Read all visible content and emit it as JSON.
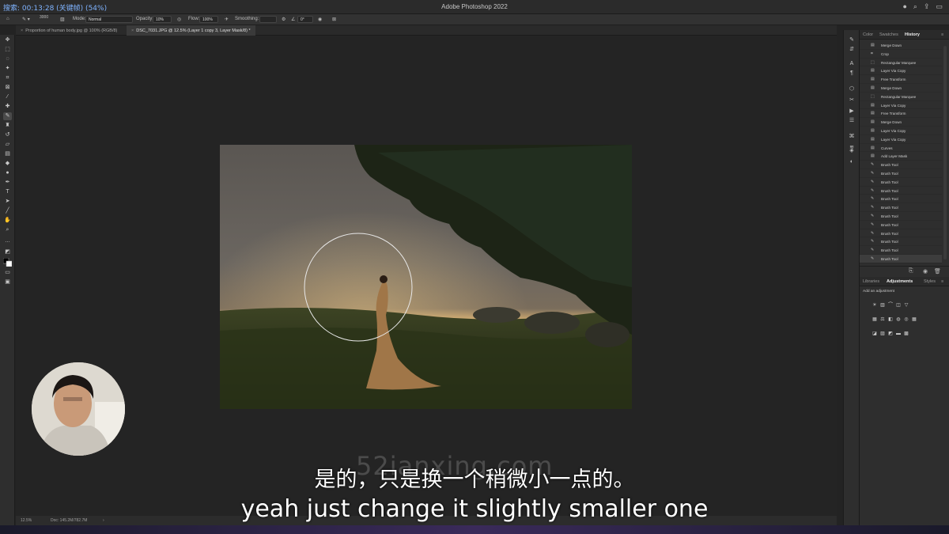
{
  "titlebar": {
    "recording": "搜索: 00:13:28 (关键帧) (54%)",
    "app_title": "Adobe Photoshop 2022"
  },
  "options_bar": {
    "brush_size": "3000",
    "mode_label": "Mode:",
    "mode_value": "Normal",
    "opacity_label": "Opacity:",
    "opacity_value": "10%",
    "flow_label": "Flow:",
    "flow_value": "100%",
    "smoothing_label": "Smoothing:",
    "angle_value": "0°"
  },
  "tabs": [
    {
      "label": "Proportion of human body.jpg @ 100% (RGB/8)"
    },
    {
      "label": "DSC_7031.JPG @ 12.5% (Layer 1 copy 3, Layer Mask/8) *"
    }
  ],
  "status_bar": {
    "zoom": "12.5%",
    "doc": "Doc: 145.2M/782.7M"
  },
  "panel": {
    "tabs": [
      "Color",
      "Swatches",
      "History"
    ],
    "active_tab": "History",
    "history": [
      {
        "icon": "layer-icon",
        "label": "Merge Down"
      },
      {
        "icon": "crop-icon",
        "label": "Crop"
      },
      {
        "icon": "marquee-icon",
        "label": "Rectangular Marquee"
      },
      {
        "icon": "layer-icon",
        "label": "Layer Via Copy"
      },
      {
        "icon": "layer-icon",
        "label": "Free Transform"
      },
      {
        "icon": "layer-icon",
        "label": "Merge Down"
      },
      {
        "icon": "marquee-icon",
        "label": "Rectangular Marquee"
      },
      {
        "icon": "layer-icon",
        "label": "Layer Via Copy"
      },
      {
        "icon": "layer-icon",
        "label": "Free Transform"
      },
      {
        "icon": "layer-icon",
        "label": "Merge Down"
      },
      {
        "icon": "layer-icon",
        "label": "Layer Via Copy"
      },
      {
        "icon": "layer-icon",
        "label": "Layer Via Copy"
      },
      {
        "icon": "layer-icon",
        "label": "Curves"
      },
      {
        "icon": "layer-icon",
        "label": "Add Layer Mask"
      },
      {
        "icon": "brush-icon",
        "label": "Brush Tool"
      },
      {
        "icon": "brush-icon",
        "label": "Brush Tool"
      },
      {
        "icon": "brush-icon",
        "label": "Brush Tool"
      },
      {
        "icon": "brush-icon",
        "label": "Brush Tool"
      },
      {
        "icon": "brush-icon",
        "label": "Brush Tool"
      },
      {
        "icon": "brush-icon",
        "label": "Brush Tool"
      },
      {
        "icon": "brush-icon",
        "label": "Brush Tool"
      },
      {
        "icon": "brush-icon",
        "label": "Brush Tool"
      },
      {
        "icon": "brush-icon",
        "label": "Brush Tool"
      },
      {
        "icon": "brush-icon",
        "label": "Brush Tool"
      },
      {
        "icon": "brush-icon",
        "label": "Brush Tool"
      },
      {
        "icon": "brush-icon",
        "label": "Brush Tool"
      }
    ],
    "adjust_tabs": [
      "Libraries",
      "Adjustments",
      "Styles"
    ],
    "adjust_active": "Adjustments",
    "add_adjustment": "Add an adjustment"
  },
  "watermark": "52ianxing.com",
  "subtitles": {
    "zh": "是的，只是换一个稍微小一点的。",
    "en": "yeah just change it slightly smaller one"
  },
  "colors": {
    "accent": "#7fb3ff",
    "panel_bg": "#2e2e2e",
    "canvas_bg": "#242424"
  }
}
